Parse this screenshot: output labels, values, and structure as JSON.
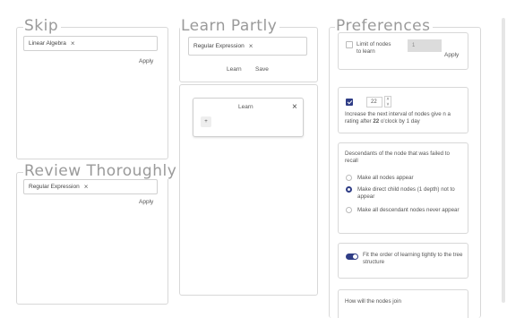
{
  "skip": {
    "title": "Skip",
    "tag_label": "Linear Algebra",
    "tag_remove": "×",
    "apply_label": "Apply"
  },
  "review": {
    "title": "Review Thoroughly",
    "tag_label": "Regular Expression",
    "tag_remove": "×",
    "apply_label": "Apply"
  },
  "learn_partly": {
    "title": "Learn Partly",
    "tag_label": "Regular Expression",
    "tag_remove": "×",
    "learn_label": "Learn",
    "save_label": "Save",
    "card": {
      "title": "Learn",
      "close": "×",
      "add_button": "+"
    }
  },
  "preferences": {
    "title": "Preferences",
    "limit": {
      "label": "Limit of nodes to learn",
      "checked": false,
      "value": "1",
      "apply_label": "Apply"
    },
    "interval": {
      "checked": true,
      "value": "22",
      "up": "˄",
      "down": "˅",
      "text_before": "Increase the next interval of nodes give n a rating after ",
      "hour": "22",
      "text_after": " o'clock by 1 day"
    },
    "descendants": {
      "heading": "Descendants of the node that was failed to recall",
      "options": [
        {
          "label": "Make all nodes appear",
          "checked": false
        },
        {
          "label": "Make direct child nodes (1 depth) not to appear",
          "checked": true
        },
        {
          "label": "Make all descendant nodes never appear",
          "checked": false
        }
      ]
    },
    "fit_order": {
      "label": "Fit the order of learning tightly to the tree structure",
      "on": true
    },
    "partial_text": "How will the nodes join"
  },
  "colors": {
    "accent": "#2f3d86",
    "border": "#d8d8d8",
    "title": "#9a9a9a"
  }
}
